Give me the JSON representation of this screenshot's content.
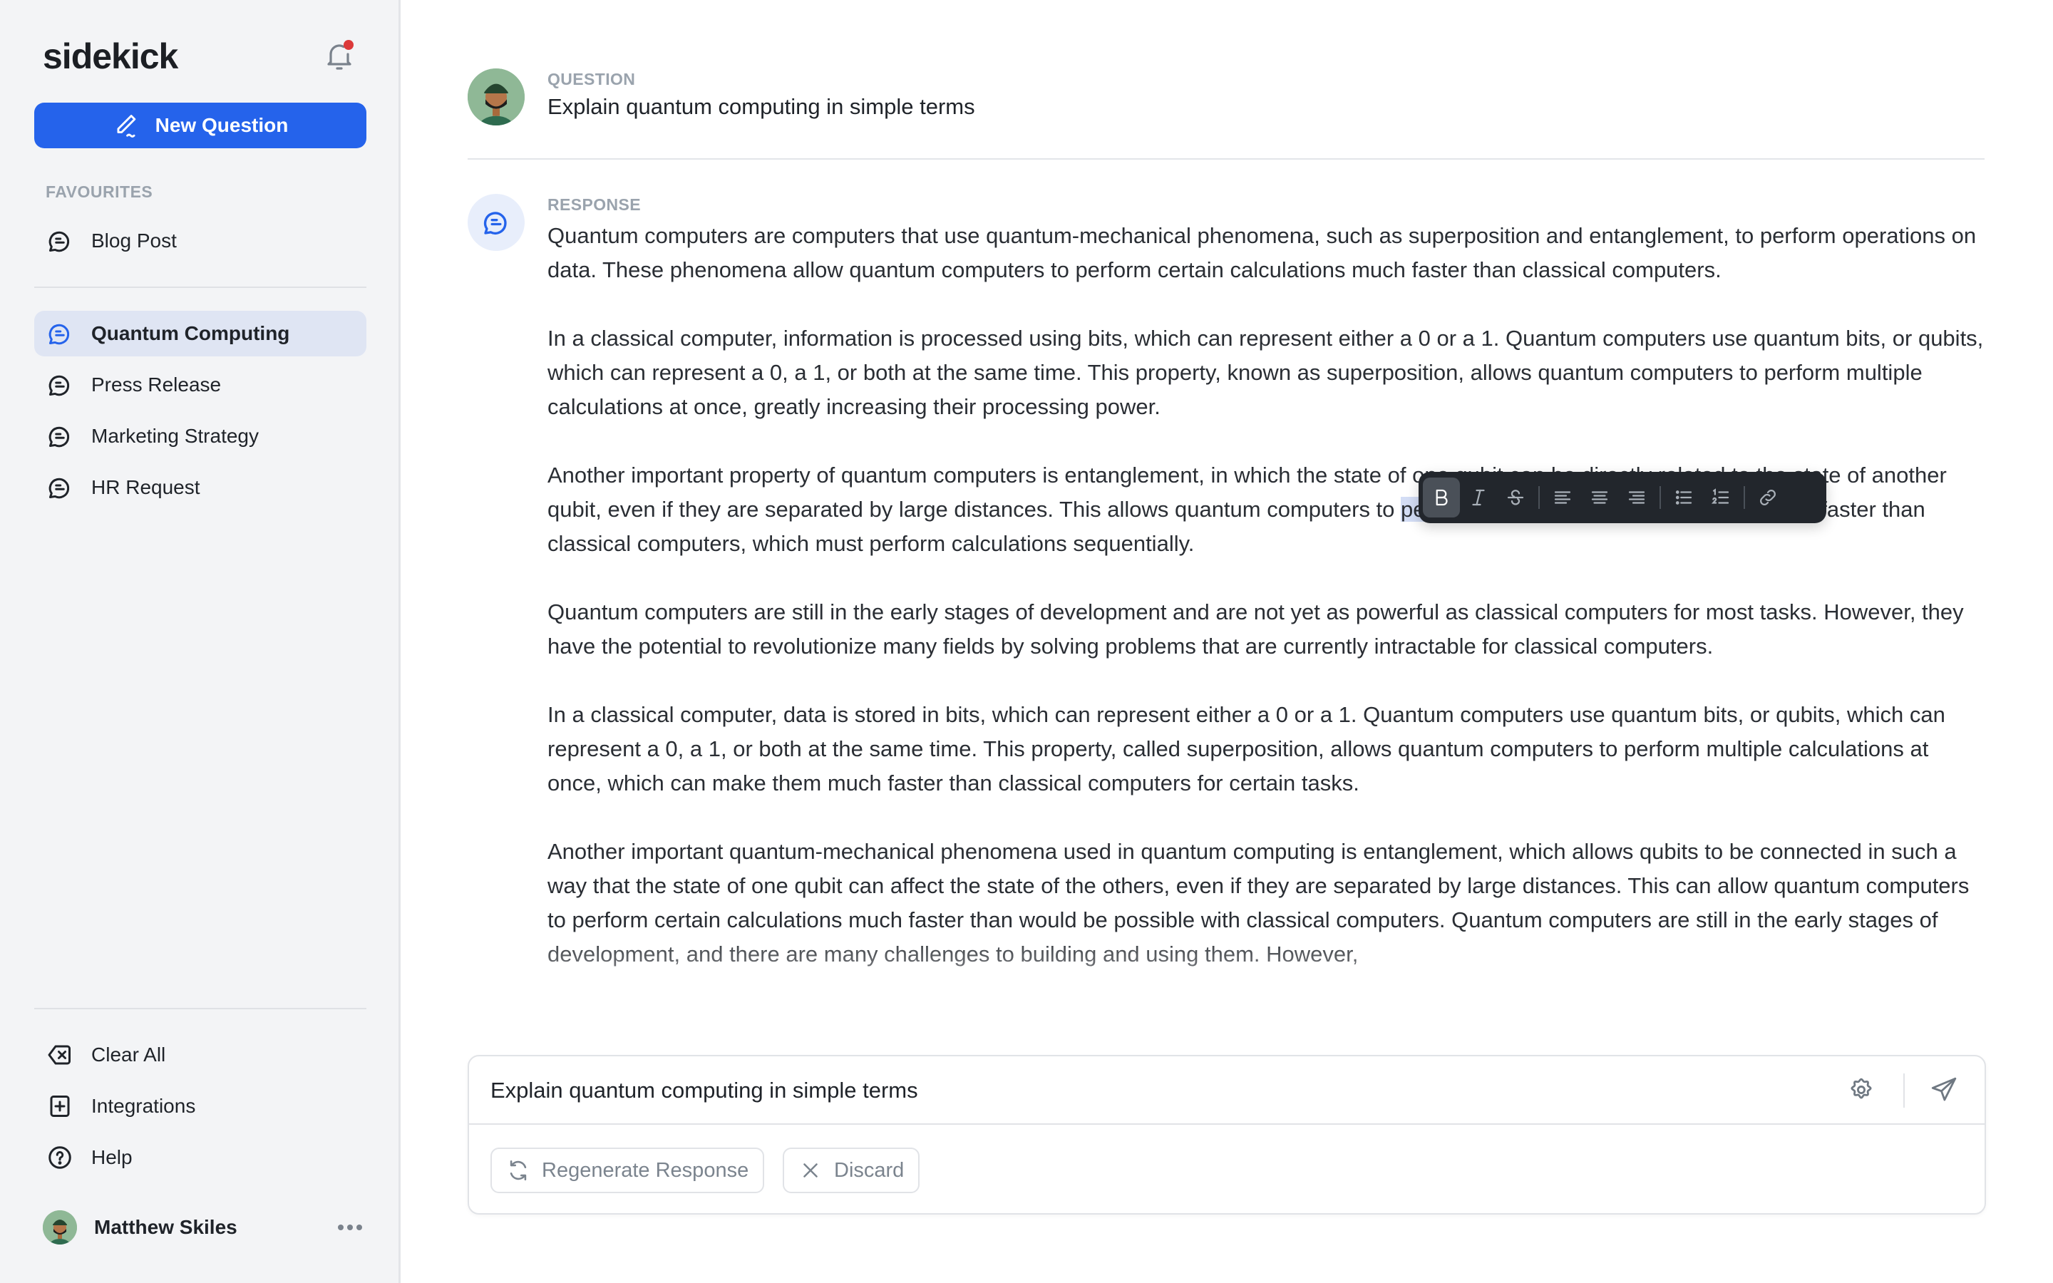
{
  "app": {
    "name": "sidekick",
    "accent_color": "#2563eb",
    "notification_dot_color": "#dc3a3a",
    "has_unread_notifications": true
  },
  "sidebar": {
    "new_question_label": "New Question",
    "favourites_label": "FAVOURITES",
    "favourites": [
      {
        "label": "Blog Post",
        "icon": "chat-bubble-icon"
      }
    ],
    "conversations": [
      {
        "label": "Quantum Computing",
        "icon": "chat-bubble-icon",
        "active": true
      },
      {
        "label": "Press Release",
        "icon": "chat-bubble-icon",
        "active": false
      },
      {
        "label": "Marketing Strategy",
        "icon": "chat-bubble-icon",
        "active": false
      },
      {
        "label": "HR Request",
        "icon": "chat-bubble-icon",
        "active": false
      }
    ],
    "footer_items": [
      {
        "label": "Clear All",
        "icon": "clear-backspace-icon"
      },
      {
        "label": "Integrations",
        "icon": "plus-square-icon"
      },
      {
        "label": "Help",
        "icon": "help-circle-icon"
      }
    ],
    "user": {
      "name": "Matthew Skiles",
      "menu_icon": "more-horizontal-icon"
    }
  },
  "conversation": {
    "question_label": "QUESTION",
    "question_text": "Explain quantum computing in simple terms",
    "response_label": "RESPONSE",
    "response_paragraphs": [
      "Quantum computers are computers that use quantum-mechanical phenomena, such as superposition and entanglement, to perform operations on data. These phenomena allow quantum computers to perform certain calculations much faster than classical computers.",
      "In a classical computer, information is processed using bits, which can represent either a 0 or a 1. Quantum computers use quantum bits, or qubits, which can represent a 0, a 1, or both at the same time. This property, known as superposition, allows quantum computers to perform multiple calculations at once, greatly increasing their processing power.",
      {
        "before": "Another important property of quantum computers is entanglement, in which the state of one qubit can be directly related to the state of another qubit, even if they are separated by large distances. This allows quantum computers to ",
        "selected": "perform",
        "after": " certain types of calculations much faster than classical computers, which must perform calculations sequentially."
      },
      "Quantum computers are still in the early stages of development and are not yet as powerful as classical computers for most tasks. However, they have the potential to revolutionize many fields by solving problems that are currently intractable for classical computers.",
      "In a classical computer, data is stored in bits, which can represent either a 0 or a 1. Quantum computers use quantum bits, or qubits, which can represent a 0, a 1, or both at the same time. This property, called superposition, allows quantum computers to perform multiple calculations at once, which can make them much faster than classical computers for certain tasks.",
      "Another important quantum-mechanical phenomena used in quantum computing is entanglement, which allows qubits to be connected in such a way that the state of one qubit can affect the state of the others, even if they are separated by large distances. This can allow quantum computers to perform certain calculations much faster than would be possible with classical computers. Quantum computers are still in the early stages of development, and there are many challenges to building and using them. However,"
    ],
    "selected_word": "perform"
  },
  "format_toolbar": {
    "buttons": [
      {
        "name": "bold",
        "icon": "bold-icon",
        "active": true
      },
      {
        "name": "italic",
        "icon": "italic-icon",
        "active": false
      },
      {
        "name": "strikethrough",
        "icon": "strikethrough-icon",
        "active": false
      },
      {
        "name": "align-left",
        "icon": "align-left-icon",
        "active": false
      },
      {
        "name": "align-center",
        "icon": "align-center-icon",
        "active": false
      },
      {
        "name": "align-right",
        "icon": "align-right-icon",
        "active": false
      },
      {
        "name": "bullet-list",
        "icon": "bullet-list-icon",
        "active": false
      },
      {
        "name": "numbered-list",
        "icon": "numbered-list-icon",
        "active": false
      },
      {
        "name": "link",
        "icon": "link-icon",
        "active": false
      }
    ]
  },
  "composer": {
    "input_value": "Explain quantum computing in simple terms",
    "settings_icon": "gear-icon",
    "send_icon": "send-icon",
    "regenerate_label": "Regenerate Response",
    "discard_label": "Discard"
  }
}
